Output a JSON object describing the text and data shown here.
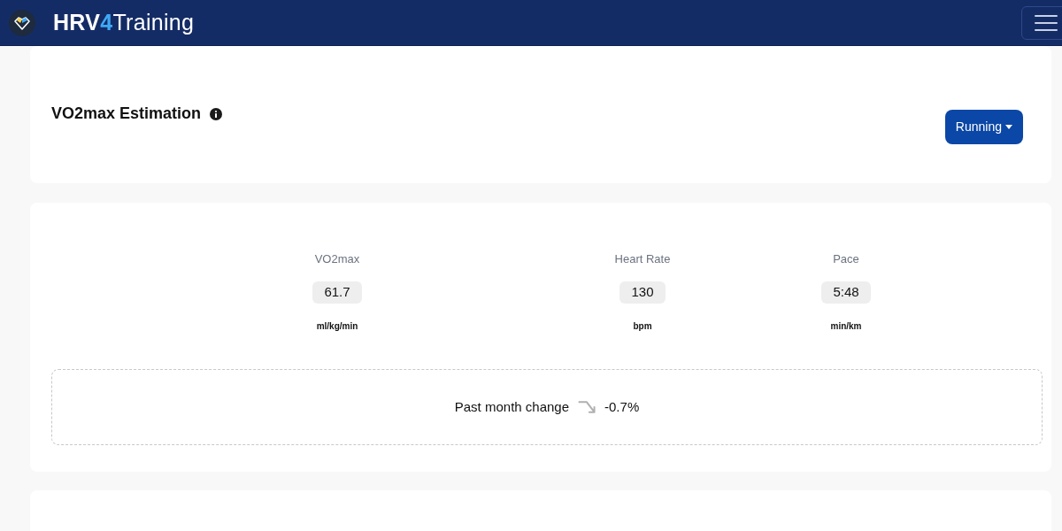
{
  "navbar": {
    "brand": [
      {
        "text": "HRV",
        "kind": "bold"
      },
      {
        "text": "4",
        "kind": "accent"
      },
      {
        "text": "Training",
        "kind": "light"
      }
    ]
  },
  "header": {
    "title": "VO2max Estimation",
    "sport_dropdown": {
      "label": "Running"
    }
  },
  "stats": [
    {
      "label": "VO2max",
      "value": "61.7",
      "unit": "ml/kg/min"
    },
    {
      "label": "Heart Rate",
      "value": "130",
      "unit": "bpm"
    },
    {
      "label": "Pace",
      "value": "5:48",
      "unit": "min/km"
    }
  ],
  "change": {
    "label": "Past month change",
    "value": "-0.7%"
  }
}
